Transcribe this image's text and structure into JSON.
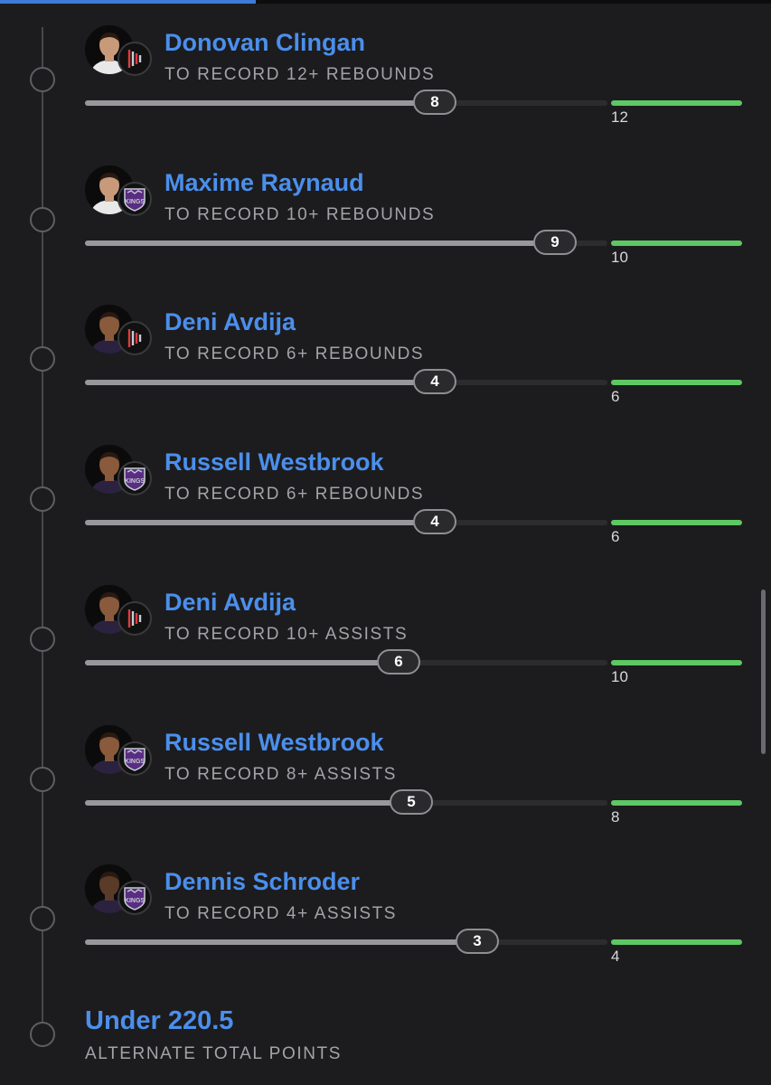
{
  "colors": {
    "background": "#1c1c1e",
    "accent_blue": "#4b8fec",
    "target_green": "#5dc864",
    "progress_fill": "#98989c"
  },
  "legs": [
    {
      "player": "Donovan Clingan",
      "team": "Portland Trail Blazers",
      "team_icon": "blazers-logo-icon",
      "prop": "TO RECORD 12+ REBOUNDS",
      "current": "8",
      "target": "12",
      "progress": 0.67
    },
    {
      "player": "Maxime Raynaud",
      "team": "Sacramento Kings",
      "team_icon": "kings-logo-icon",
      "prop": "TO RECORD 10+ REBOUNDS",
      "current": "9",
      "target": "10",
      "progress": 0.9
    },
    {
      "player": "Deni Avdija",
      "team": "Portland Trail Blazers",
      "team_icon": "blazers-logo-icon",
      "prop": "TO RECORD 6+ REBOUNDS",
      "current": "4",
      "target": "6",
      "progress": 0.67
    },
    {
      "player": "Russell Westbrook",
      "team": "Sacramento Kings",
      "team_icon": "kings-logo-icon",
      "prop": "TO RECORD 6+ REBOUNDS",
      "current": "4",
      "target": "6",
      "progress": 0.67
    },
    {
      "player": "Deni Avdija",
      "team": "Portland Trail Blazers",
      "team_icon": "blazers-logo-icon",
      "prop": "TO RECORD 10+ ASSISTS",
      "current": "6",
      "target": "10",
      "progress": 0.6
    },
    {
      "player": "Russell Westbrook",
      "team": "Sacramento Kings",
      "team_icon": "kings-logo-icon",
      "prop": "TO RECORD 8+ ASSISTS",
      "current": "5",
      "target": "8",
      "progress": 0.625
    },
    {
      "player": "Dennis Schroder",
      "team": "Sacramento Kings",
      "team_icon": "kings-logo-icon",
      "prop": "TO RECORD 4+ ASSISTS",
      "current": "3",
      "target": "4",
      "progress": 0.75
    }
  ],
  "total": {
    "title": "Under 220.5",
    "subtitle": "ALTERNATE TOTAL POINTS"
  }
}
